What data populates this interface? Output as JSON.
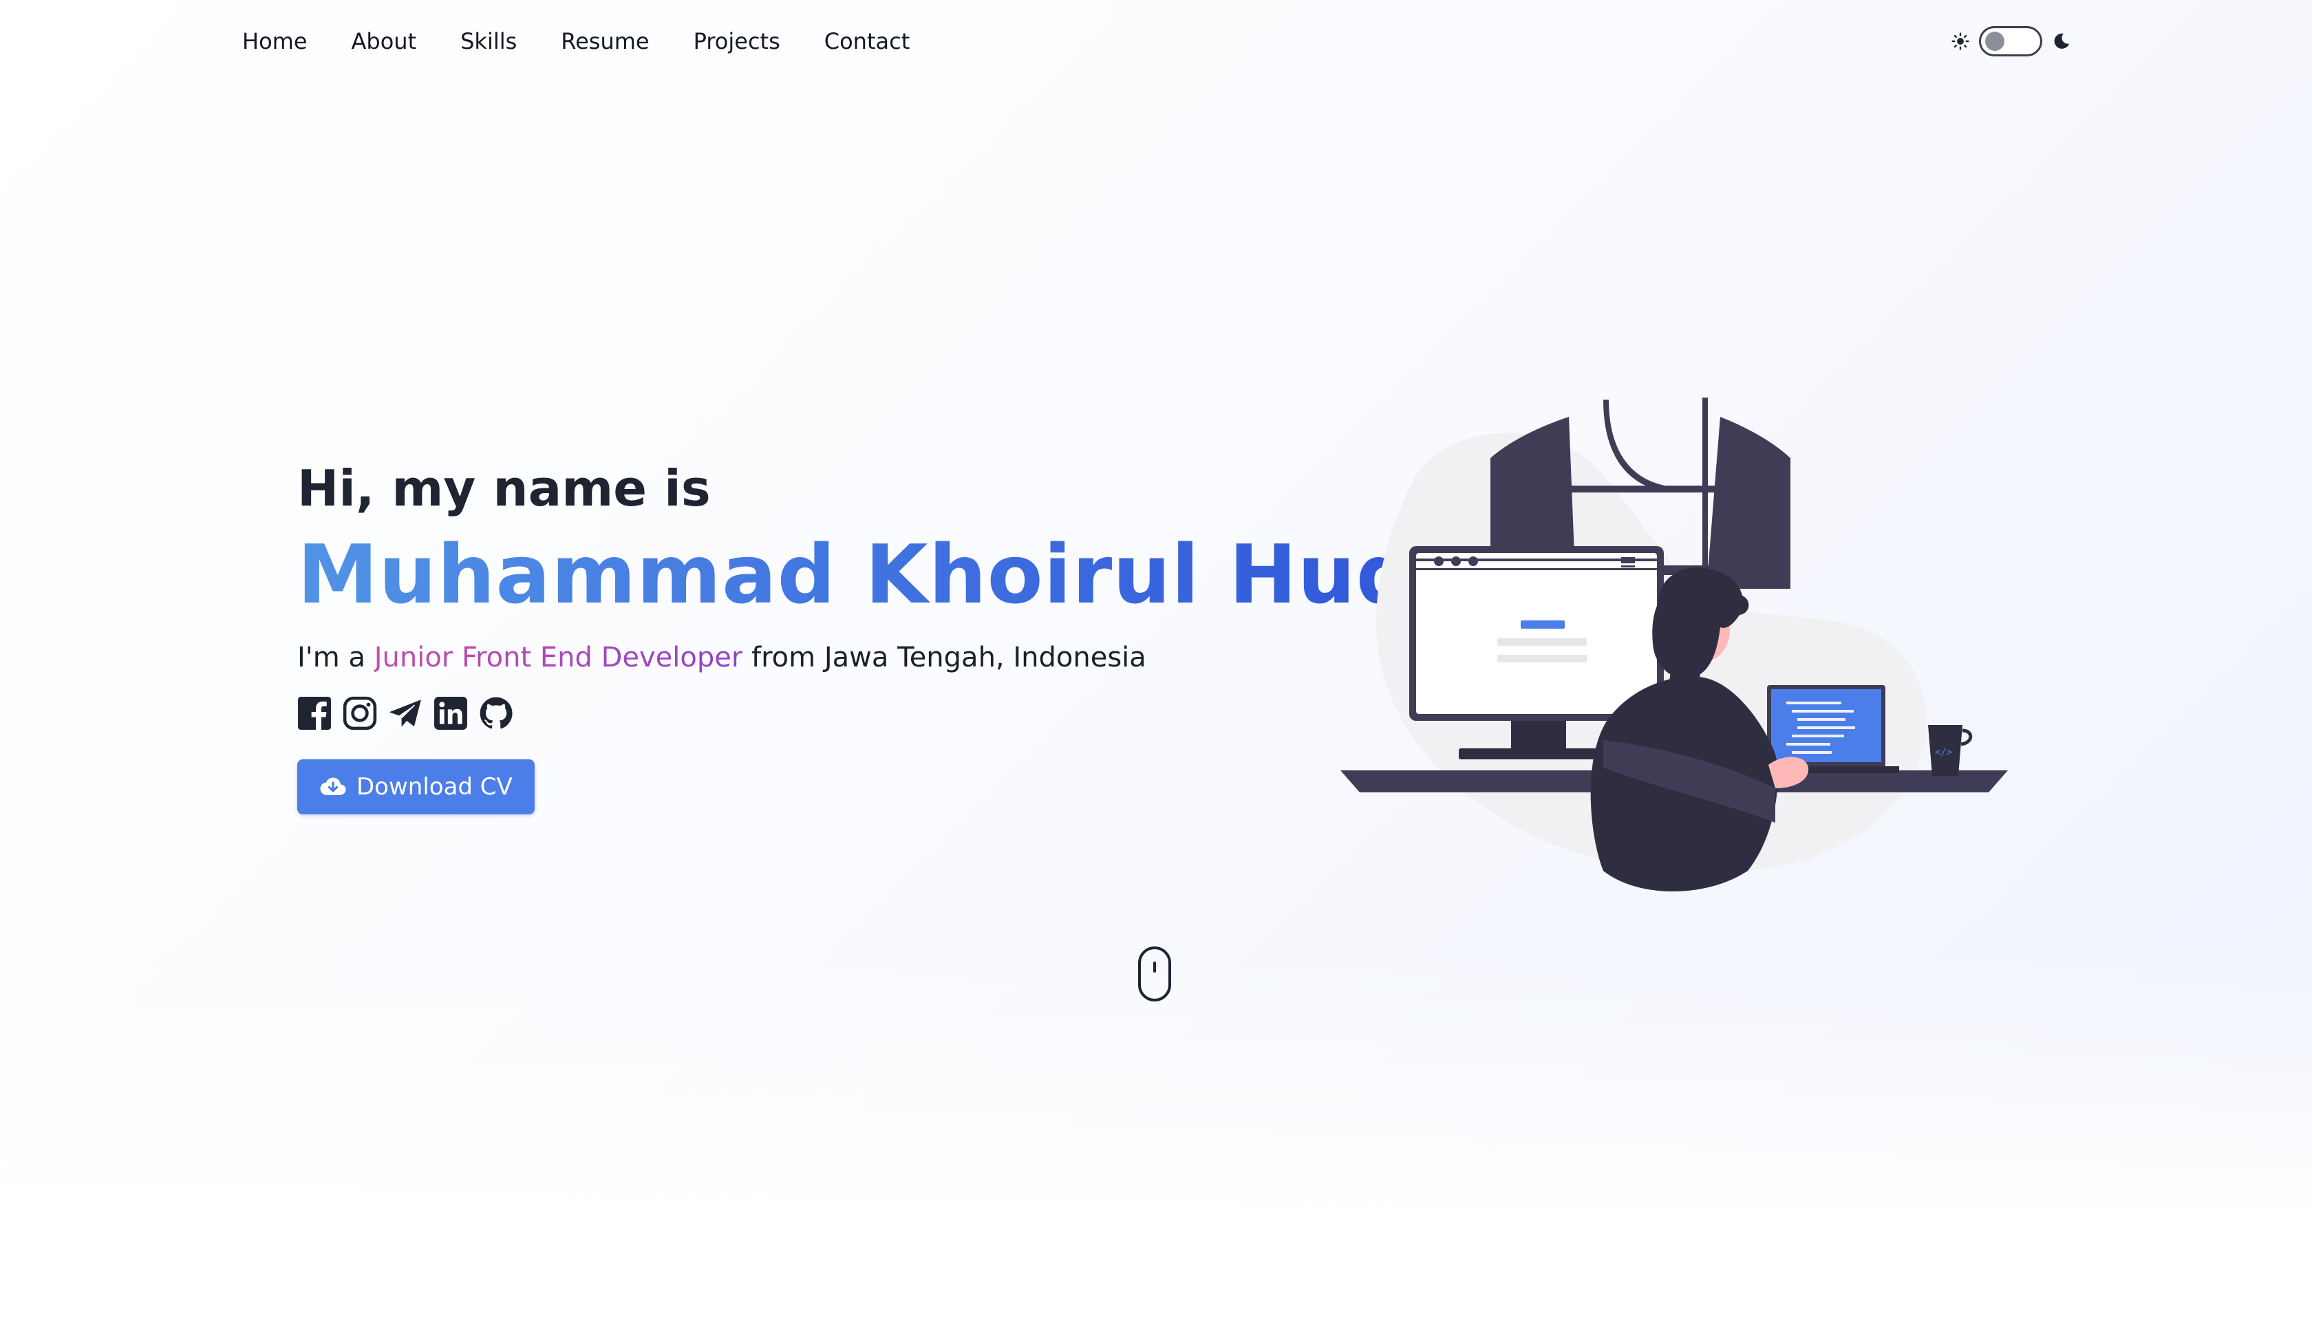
{
  "nav": {
    "items": [
      {
        "label": "Home"
      },
      {
        "label": "About"
      },
      {
        "label": "Skills"
      },
      {
        "label": "Resume"
      },
      {
        "label": "Projects"
      },
      {
        "label": "Contact"
      }
    ]
  },
  "theme_toggle": {
    "light_icon": "sun-icon",
    "dark_icon": "moon-icon",
    "state": "light"
  },
  "hero": {
    "greeting": "Hi, my name is",
    "name": "Muhammad Khoirul Huda",
    "tagline_prefix": "I'm a ",
    "role": "Junior Front End Developer",
    "tagline_suffix": " from Jawa Tengah, Indonesia",
    "socials": [
      "facebook-icon",
      "instagram-icon",
      "telegram-icon",
      "linkedin-icon",
      "github-icon"
    ],
    "cv_button": {
      "label": "Download CV",
      "icon": "cloud-download-icon"
    }
  },
  "colors": {
    "accent": "#4b7ee8",
    "name_gradient_start": "#5193e6",
    "name_gradient_end": "#2f55d8",
    "role_gradient_start": "#c44dab",
    "role_gradient_end": "#8e44c9",
    "text": "#1f2433"
  },
  "scroll_indicator": "mouse-scroll-icon"
}
